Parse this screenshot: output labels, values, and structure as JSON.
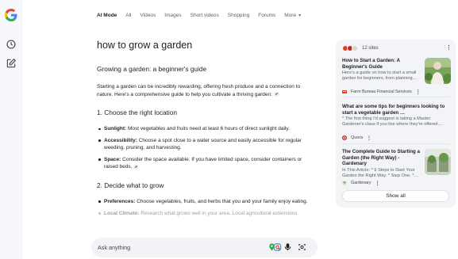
{
  "nav": {
    "tabs": [
      {
        "label": "AI Mode",
        "active": true
      },
      {
        "label": "All"
      },
      {
        "label": "Videos"
      },
      {
        "label": "Images"
      },
      {
        "label": "Short videos"
      },
      {
        "label": "Shopping"
      },
      {
        "label": "Forums"
      },
      {
        "label": "More"
      }
    ]
  },
  "rail": {
    "icons": [
      "google-logo",
      "history-icon",
      "new-chat-icon"
    ]
  },
  "main": {
    "query": "how to grow a garden",
    "heading": "Growing a garden: a beginner's guide",
    "intro": "Starting a garden can be incredibly rewarding, offering fresh produce and a connection to nature. Here's a comprehensive guide to help you cultivate a thriving garden:",
    "section1": {
      "title": "1. Choose the right location",
      "items": [
        {
          "term": "Sunlight:",
          "text": " Most vegetables and fruits need at least 6 hours of direct sunlight daily."
        },
        {
          "term": "Accessibility:",
          "text": " Choose a spot close to a water source and easily accessible for regular weeding, pruning, and harvesting."
        },
        {
          "term": "Space:",
          "text": " Consider the space available. If you have limited space, consider containers or raised beds,"
        }
      ]
    },
    "section2": {
      "title": "2. Decide what to grow",
      "items": [
        {
          "term": "Preferences:",
          "text": " Choose vegetables, fruits, and herbs that you and your family enjoy eating."
        },
        {
          "term": "Local Climate:",
          "text": " Research what grows well in your area. Local agricultural extensions"
        }
      ]
    }
  },
  "askbar": {
    "placeholder": "Ask anything"
  },
  "panel": {
    "sites_count": "12 sites",
    "kebab": "⋮",
    "sources": [
      {
        "title": "How to Start a Garden: A Beginner's Guide",
        "snippet": "Here's a guide on how to start a small garden for beginners, from planning…",
        "source": "Farm Bureau Financial Services"
      },
      {
        "title": "What are some tips for beginners looking to start a vegetable garden …",
        "snippet": "* The first thing I'd suggest is taking a Master Gardener's class if you live where they're offered.…",
        "source": "Quora"
      },
      {
        "title": "The Complete Guide to Starting a Garden (the Right Way) - Gardenary",
        "snippet": "In This Article: * 9 Steps to Start Your Garden the Right Way. * Step One. *…",
        "source": "Gardenary"
      }
    ],
    "show_all": "Show all"
  },
  "colors": {
    "rail_bg": "#f6f8fb",
    "panel_bg": "#f2f4f7",
    "askbar_bg": "#f1f3f6",
    "text": "#1f1f1f",
    "muted": "#5f6368",
    "google_blue": "#4285f4",
    "google_red": "#ea4335",
    "google_yellow": "#fbbc05",
    "google_green": "#34a853"
  }
}
